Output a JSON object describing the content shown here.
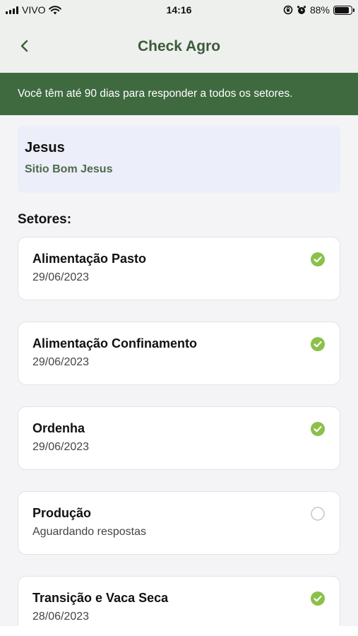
{
  "status_bar": {
    "carrier": "VIVO",
    "time": "14:16",
    "battery_percent_label": "88%",
    "battery_level": 0.88,
    "icons": [
      "signal-icon",
      "wifi-icon",
      "orientation-lock-icon",
      "alarm-icon",
      "battery-icon"
    ]
  },
  "header": {
    "title": "Check Agro",
    "back_icon": "chevron-left-icon"
  },
  "notice": {
    "text": "Você têm até 90 dias para responder a todos os setores."
  },
  "farm": {
    "owner": "Jesus",
    "name": "Sitio Bom Jesus"
  },
  "sectors_title": "Setores:",
  "sectors": [
    {
      "name": "Alimentação Pasto",
      "status": "29/06/2023",
      "completed": true
    },
    {
      "name": "Alimentação Confinamento",
      "status": "29/06/2023",
      "completed": true
    },
    {
      "name": "Ordenha",
      "status": "29/06/2023",
      "completed": true
    },
    {
      "name": "Produção",
      "status": "Aguardando respostas",
      "completed": false
    },
    {
      "name": "Transição e Vaca Seca",
      "status": "28/06/2023",
      "completed": true
    }
  ],
  "colors": {
    "brand_green": "#3f6a40",
    "title_green": "#3d5a3a",
    "check_green": "#8cc04b",
    "pending_gray": "#c8c8c8"
  }
}
